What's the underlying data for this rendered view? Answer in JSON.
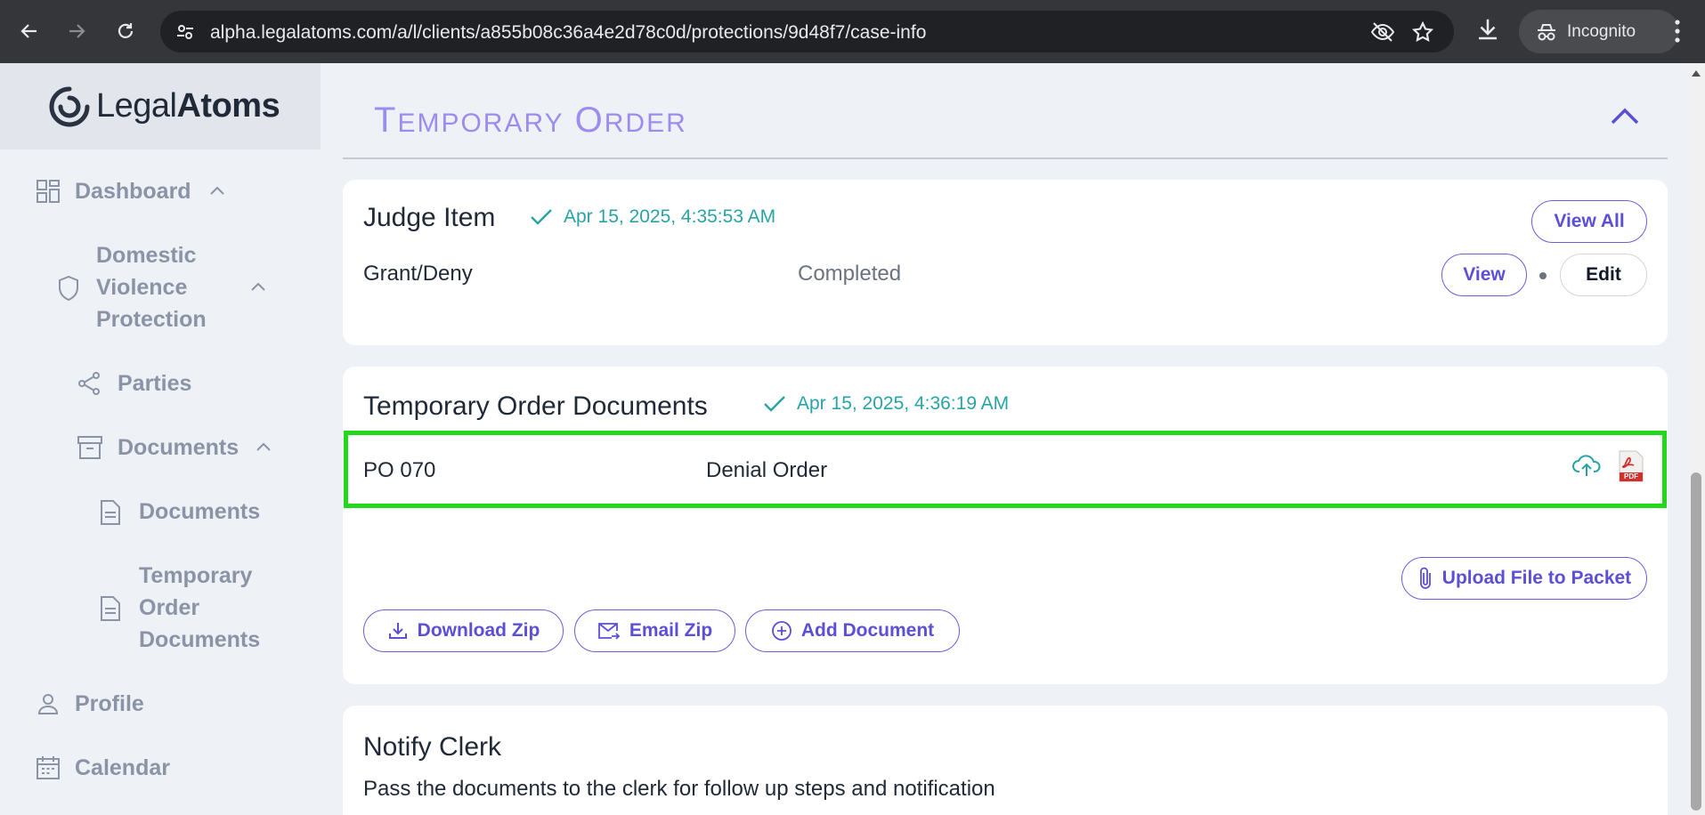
{
  "browser": {
    "url": "alpha.legalatoms.com/a/l/clients/a855b08c36a4e2d78c0d/protections/9d48f7/case-info",
    "incognito_label": "Incognito"
  },
  "logo": {
    "part1": "Legal",
    "part2": "Atoms"
  },
  "sidebar": {
    "dashboard": "Dashboard",
    "dv_line1": "Domestic",
    "dv_line2": "Violence",
    "dv_line3": "Protection",
    "parties": "Parties",
    "documents": "Documents",
    "documents_sub": "Documents",
    "temp_line1": "Temporary",
    "temp_line2": "Order",
    "temp_line3": "Documents",
    "profile": "Profile",
    "calendar": "Calendar"
  },
  "section": {
    "title_cap1": "T",
    "title_rest1": "emporary",
    "title_cap2": "O",
    "title_rest2": "rder"
  },
  "judge_card": {
    "title": "Judge Item",
    "timestamp": "Apr 15, 2025, 4:35:53 AM",
    "view_all": "View All",
    "row_name": "Grant/Deny",
    "row_status": "Completed",
    "view": "View",
    "edit": "Edit"
  },
  "docs_card": {
    "title": "Temporary Order Documents",
    "timestamp": "Apr 15, 2025, 4:36:19 AM",
    "row_code": "PO 070",
    "row_name": "Denial Order",
    "pdf_label": "PDF",
    "upload": "Upload File to Packet",
    "download_zip": "Download Zip",
    "email_zip": "Email Zip",
    "add_document": "Add Document"
  },
  "clerk_card": {
    "title": "Notify Clerk",
    "description": "Pass the documents to the clerk for follow up steps and notification"
  },
  "colors": {
    "accent": "#5b4fd6",
    "teal": "#2aa3a5",
    "highlight": "#22d81a",
    "section_title": "#9c8cf0"
  }
}
